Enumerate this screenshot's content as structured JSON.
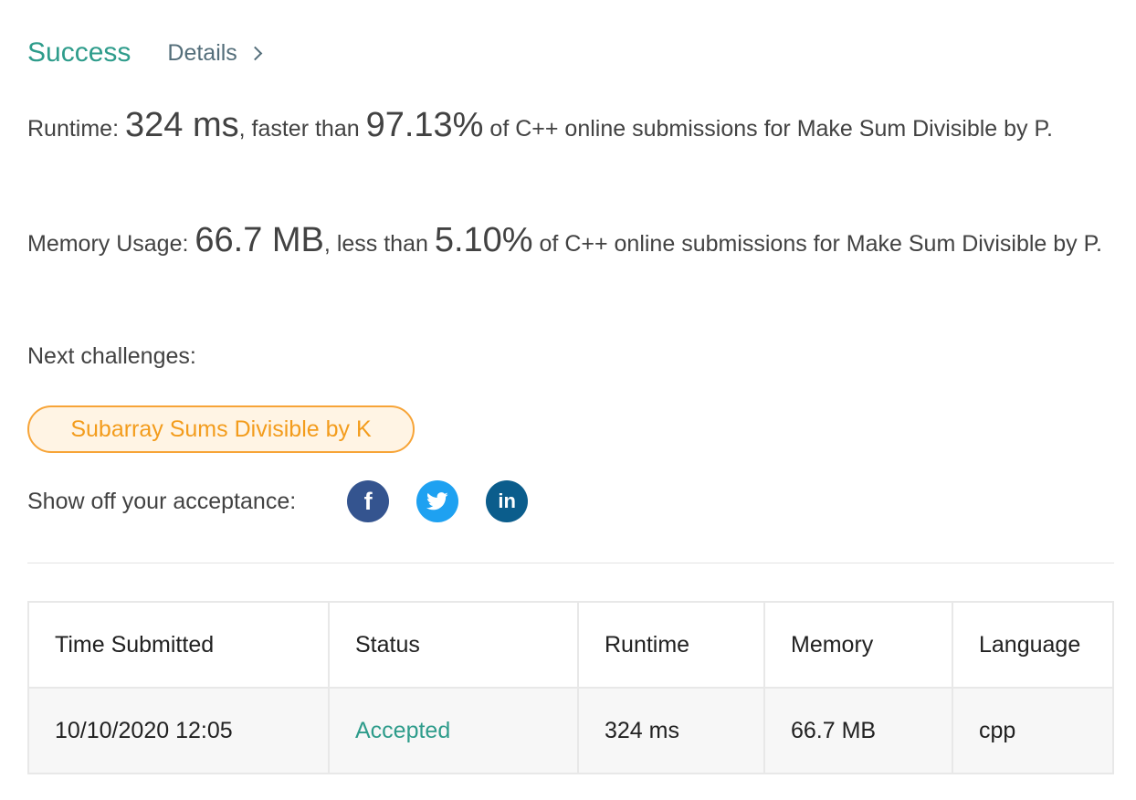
{
  "header": {
    "status": "Success",
    "details_label": "Details"
  },
  "runtime": {
    "label": "Runtime: ",
    "value": "324 ms",
    "mid": ", faster than ",
    "percent": "97.13%",
    "tail": " of C++ online submissions for Make Sum Divisible by P."
  },
  "memory": {
    "label": "Memory Usage: ",
    "value": "66.7 MB",
    "mid": ", less than ",
    "percent": "5.10%",
    "tail": " of C++ online submissions for Make Sum Divisible by P."
  },
  "next_challenges": {
    "label": "Next challenges:",
    "items": [
      "Subarray Sums Divisible by K"
    ]
  },
  "share": {
    "label": "Show off your acceptance:",
    "icons": [
      "facebook-icon",
      "twitter-icon",
      "linkedin-icon"
    ],
    "facebook_glyph": "f",
    "linkedin_glyph": "in"
  },
  "table": {
    "headers": [
      "Time Submitted",
      "Status",
      "Runtime",
      "Memory",
      "Language"
    ],
    "rows": [
      [
        "10/10/2020 12:05",
        "Accepted",
        "324 ms",
        "66.7 MB",
        "cpp"
      ]
    ]
  },
  "colors": {
    "accent": "#2e9c8b",
    "chip_border": "#f7a437",
    "chip_text": "#f39c1c",
    "facebook": "#34548f",
    "twitter": "#1ea1f1",
    "linkedin": "#0b5d8c"
  }
}
